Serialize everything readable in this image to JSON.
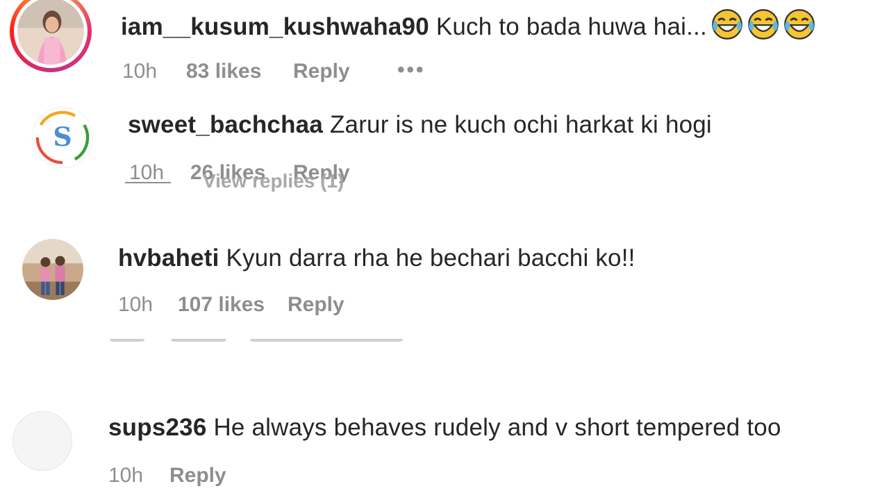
{
  "comments": [
    {
      "username": "iam__kusum_kushwaha90",
      "text": "Kuch to bada huwa hai...",
      "emoji_count": 3,
      "emoji_icon": "joy-tears-emoji-icon",
      "time": "10h",
      "likes": "83 likes",
      "reply": "Reply",
      "more": "•••",
      "ring_color": "#e1306c"
    },
    {
      "username": "sweet_bachchaa",
      "text": "Zarur is ne kuch ochi harkat ki hogi",
      "time": "10h",
      "likes": "26 likes",
      "reply": "Reply",
      "view_replies": "View replies (1)",
      "avatar_letter": "S"
    },
    {
      "username": "hvbaheti",
      "text": "Kyun darra rha he bechari bacchi ko!!",
      "time": "10h",
      "likes": "107 likes",
      "reply": "Reply"
    },
    {
      "username": "sups236",
      "text": "He always behaves rudely and v short tempered too",
      "time": "10h",
      "reply": "Reply"
    }
  ],
  "colors": {
    "text": "#262626",
    "meta": "#8e8e8e",
    "ring_gradient_start": "#fcaf45",
    "ring_gradient_end": "#e1306c"
  }
}
